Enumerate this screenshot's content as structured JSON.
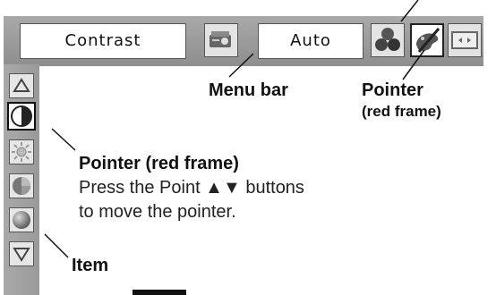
{
  "menubar": {
    "field_contrast": "Contrast",
    "field_auto": "Auto",
    "buttons": [
      {
        "icon": "projector-icon"
      },
      {
        "icon": "color-balls-icon"
      },
      {
        "icon": "pointer-palette-icon",
        "active": true
      },
      {
        "icon": "screen-size-icon"
      }
    ]
  },
  "sidebar": {
    "items": [
      {
        "icon": "up-arrow-icon"
      },
      {
        "icon": "contrast-icon",
        "active": true
      },
      {
        "icon": "brightness-icon"
      },
      {
        "icon": "color-wheel-icon"
      },
      {
        "icon": "sphere-icon"
      },
      {
        "icon": "down-arrow-icon"
      }
    ]
  },
  "annotations": {
    "menu_bar": "Menu bar",
    "pointer_top_line1": "Pointer",
    "pointer_top_line2": "(red frame)",
    "pointer_left_title": "Pointer (red frame)",
    "pointer_left_line1": "Press the Point ▲▼ buttons",
    "pointer_left_line2": "to move the pointer.",
    "item": "Item"
  }
}
